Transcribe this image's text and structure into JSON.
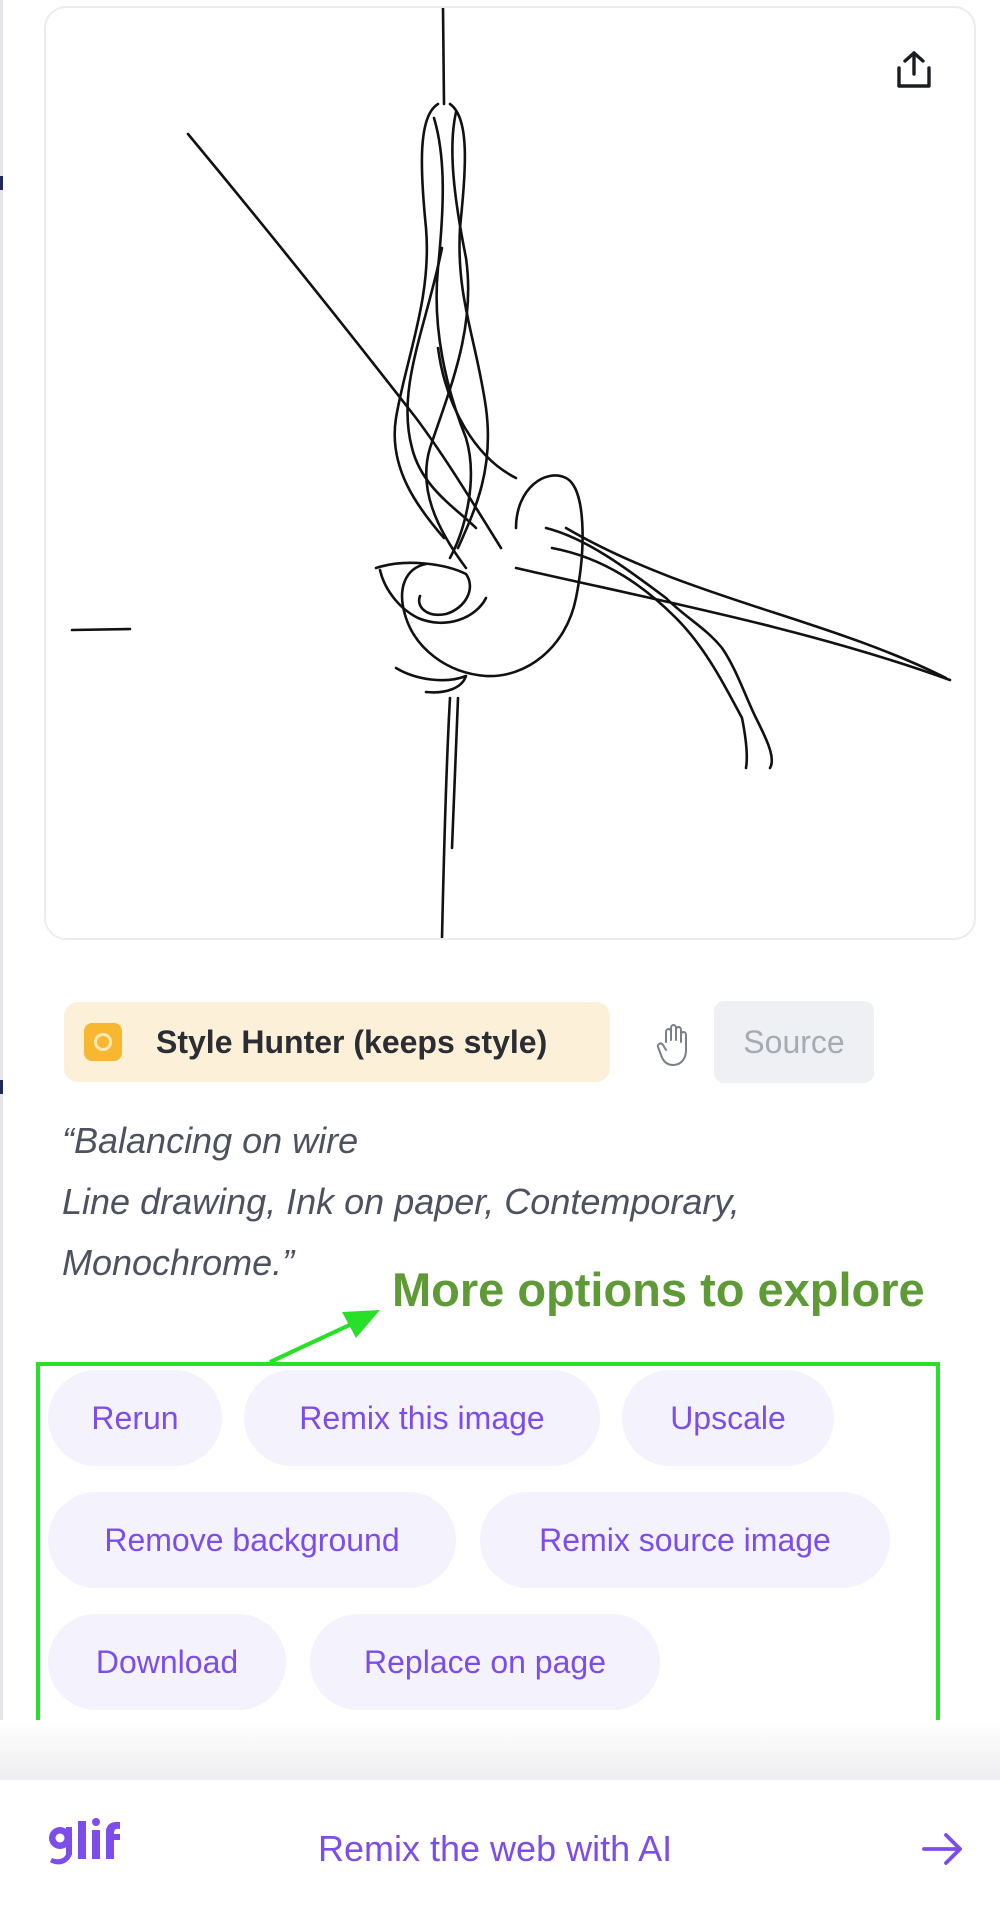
{
  "image": {
    "share_icon": "share-upload-icon"
  },
  "style_tag": {
    "label": "Style Hunter (keeps style)",
    "icon": "style-hunter-icon",
    "color": "#f7b731"
  },
  "hand_icon": "hand-grab-icon",
  "source_button": {
    "label": "Source"
  },
  "prompt": {
    "lines": [
      "“Balancing on wire",
      "Line drawing, Ink on paper, Contemporary,",
      "Monochrome.”"
    ]
  },
  "annotation": {
    "text": "More options to explore",
    "color": "#5e9a35"
  },
  "actions": [
    {
      "label": "Rerun"
    },
    {
      "label": "Remix this image"
    },
    {
      "label": "Upscale"
    },
    {
      "label": "Remove background"
    },
    {
      "label": "Remix source image"
    },
    {
      "label": "Download"
    },
    {
      "label": "Replace on page"
    }
  ],
  "footer": {
    "logo_text": "glif",
    "link": "Remix the web with AI",
    "arrow_icon": "arrow-right-icon",
    "accent": "#7c4dea"
  }
}
